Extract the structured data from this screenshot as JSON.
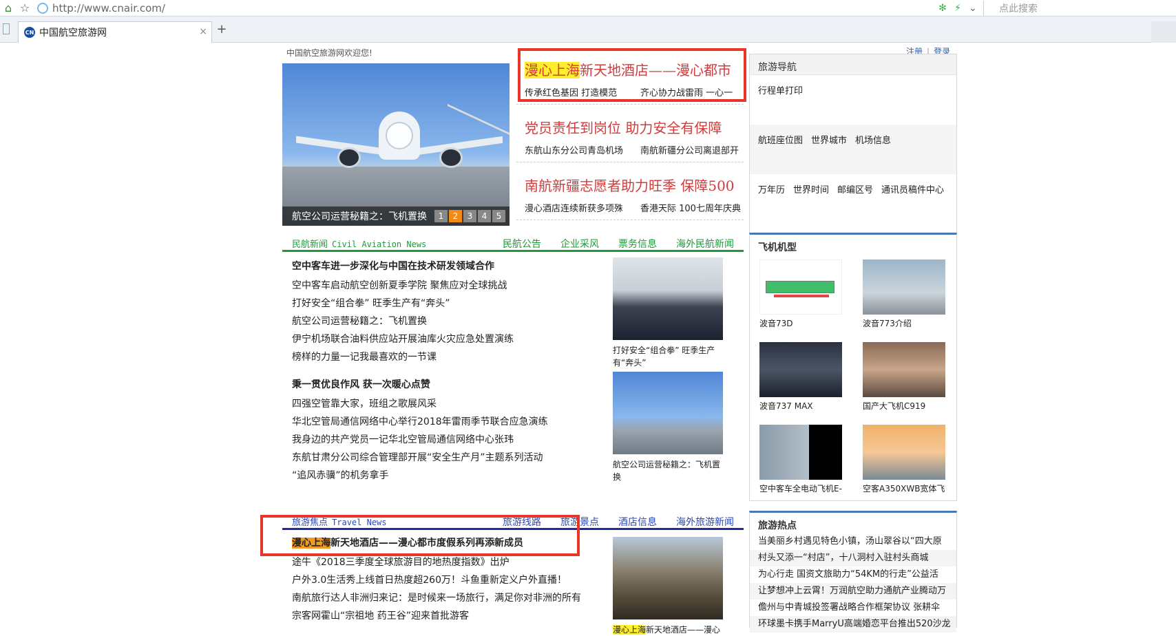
{
  "browser": {
    "url": "http://www.cnair.com/",
    "search_placeholder": "点此搜索",
    "tab_title": "中国航空旅游网",
    "tab_favicon_text": "CN",
    "tab_close": "×",
    "new_tab": "+"
  },
  "header": {
    "welcome": "中国航空旅游网欢迎您!",
    "register": "注册",
    "login": "登录",
    "sep": "|"
  },
  "focus": {
    "caption": "航空公司运营秘籍之：飞机置换",
    "pages": [
      "1",
      "2",
      "3",
      "4",
      "5"
    ],
    "active_page": 2
  },
  "headlines": [
    {
      "hit": "漫心上海",
      "title": "新天地酒店——漫心都市",
      "sub1": "传承红色基因 打造模范",
      "sub2": "齐心协力战雷雨 一心一"
    },
    {
      "hit": "",
      "title": "党员责任到岗位 助力安全有保障",
      "sub1": "东航山东分公司青岛机场",
      "sub2": "南航新疆分公司离退部开"
    },
    {
      "hit": "",
      "title": "南航新疆志愿者助力旺季 保障500",
      "sub1": "漫心酒店连续新获多项殊",
      "sub2": "香港天际 100七周年庆典"
    }
  ],
  "travel_nav": {
    "title": "旅游导航",
    "rows": [
      [
        "行程单打印"
      ],
      [
        "航班座位图",
        "世界城市",
        "机场信息"
      ],
      [
        "万年历",
        "世界时间",
        "邮编区号",
        "通讯员稿件中心"
      ]
    ]
  },
  "civil_news": {
    "title": "民航新闻",
    "title_en": "Civil Aviation News",
    "tabs": [
      "民航公告",
      "企业采风",
      "票务信息",
      "海外民航新闻"
    ],
    "group1": {
      "lead": "空中客车进一步深化与中国在技术研发领域合作",
      "items": [
        "空中客车启动航空创新夏季学院 聚焦应对全球挑战",
        "打好安全“组合拳” 旺季生产有“奔头”",
        "航空公司运营秘籍之：飞机置换",
        "伊宁机场联合油料供应站开展油库火灾应急处置演练",
        "榜样的力量一记我最喜欢的一节课"
      ]
    },
    "group2": {
      "lead": "秉一贯优良作风 获一次暖心点赞",
      "items": [
        "四强空管靠大家，班组之歌展风采",
        "华北空管局通信网络中心举行2018年雷雨季节联合应急演练",
        "我身边的共产党员一记华北空管局通信网络中心张玮",
        "东航甘肃分公司综合管理部开展“安全生产月”主题系列活动",
        "“追风赤骥”的机务拿手"
      ]
    },
    "thumb1_caption": "打好安全“组合拳” 旺季生产有“奔头”",
    "thumb2_caption": "航空公司运营秘籍之：飞机置换"
  },
  "travel_news": {
    "title": "旅游焦点",
    "title_en": "Travel News",
    "tabs": [
      "旅游线路",
      "旅游景点",
      "酒店信息",
      "海外旅游新闻"
    ],
    "lead_hit": "漫心上海",
    "lead": "新天地酒店——漫心都市度假系列再添新成员",
    "items": [
      "途牛《2018三季度全球旅游目的地热度指数》出炉",
      "户外3.0生活秀上线首日热度超260万！斗鱼重新定义户外直播！",
      "南航旅行达人非洲归来记：是时候来一场旅行，满足你对非洲的所有",
      "宗客网霍山“宗祖地 药王谷”迎来首批游客"
    ],
    "thumb_hit": "漫心上海",
    "thumb_caption": "新天地酒店——漫心"
  },
  "plane_types": {
    "title": "飞机机型",
    "items": [
      "波音73D",
      "波音773介绍",
      "波音737 MAX",
      "国产大飞机C919",
      "空中客车全电动飞机E-",
      "空客A350XWB宽体飞"
    ]
  },
  "travel_hot": {
    "title": "旅游热点",
    "items": [
      "当美丽乡村遇见特色小镇，汤山翠谷以“四大原",
      "村头又添一“村店”，十八洞村入驻村头商城",
      "为心行走 国资文旅助力“54KM的行走”公益活",
      "让梦想冲上云霄！万润航空助力通航产业腾动万",
      "儋州与中青城投签署战略合作框架协议 张耕伞",
      "环球墨卡携手MarryU高端婚恋平台推出520沙龙"
    ]
  },
  "colors": {
    "annotation_red": "#e8352a",
    "headline_red": "#d23b3b",
    "highlight_yellow": "#ffef2b",
    "highlight_orange": "#f39a1e",
    "civil_green": "#1e9a3a",
    "travel_blue": "#2b47b8"
  }
}
